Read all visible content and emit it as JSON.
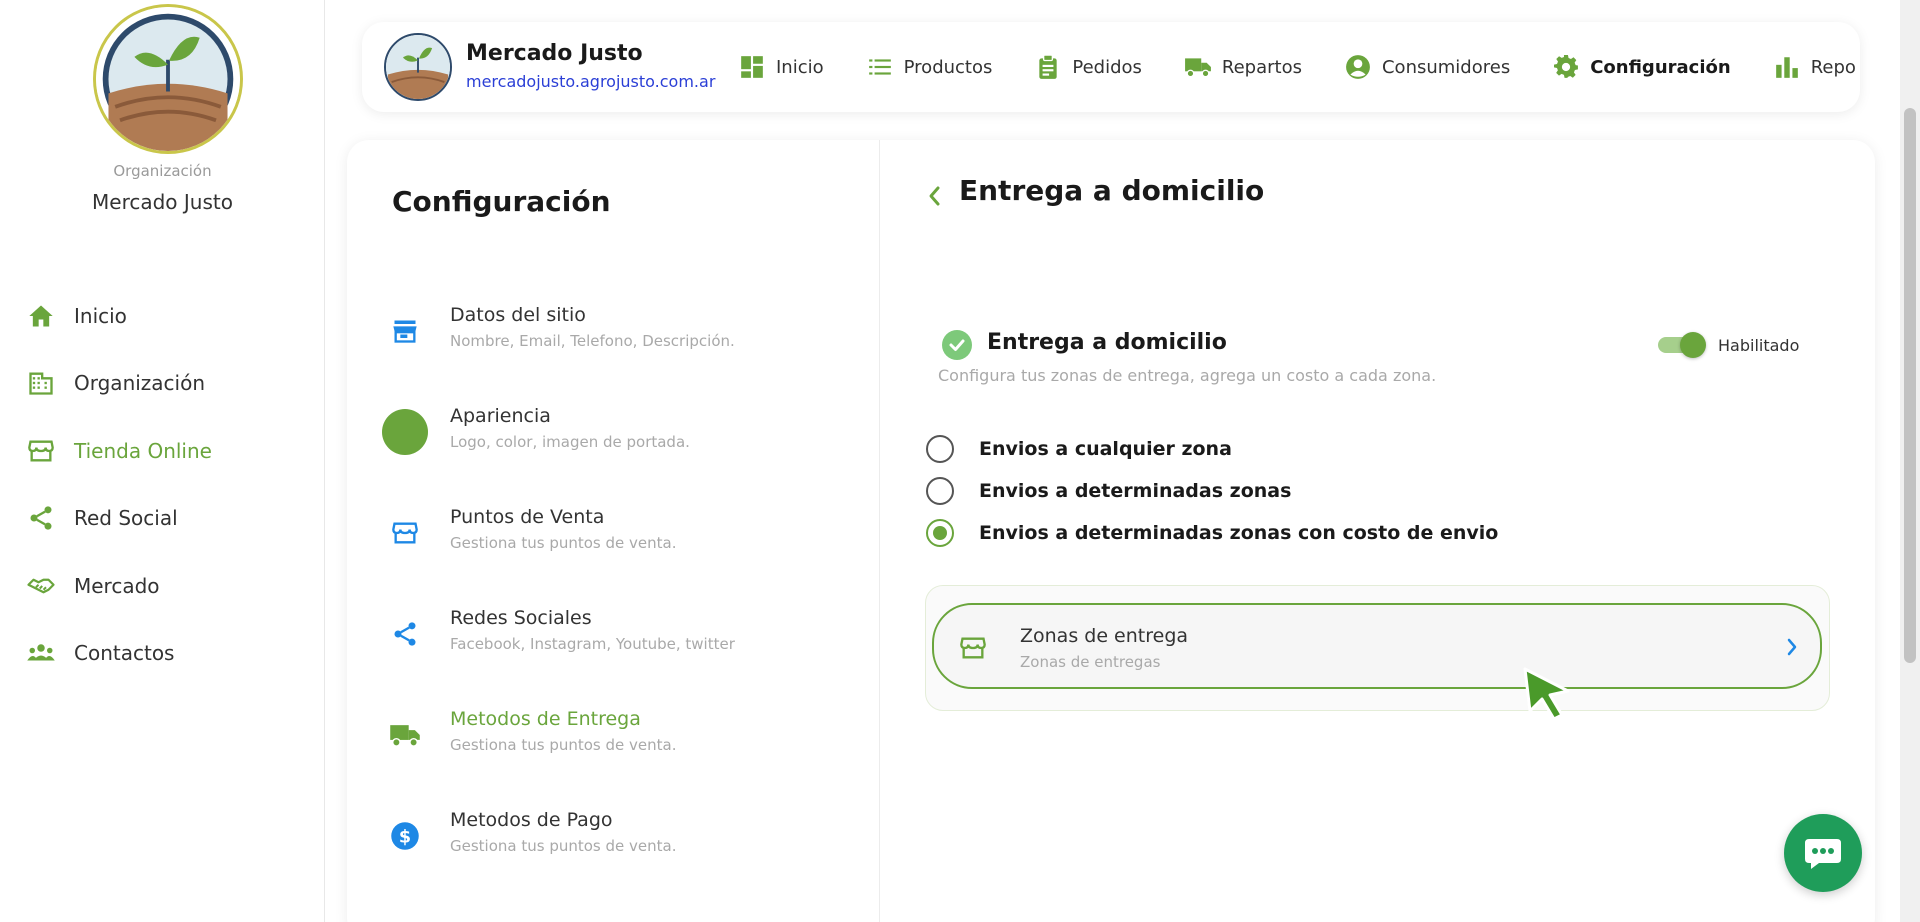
{
  "sidebar": {
    "org_caption": "Organización",
    "org_name": "Mercado Justo",
    "items": [
      {
        "label": "Inicio",
        "icon": "home-icon"
      },
      {
        "label": "Organización",
        "icon": "building-icon"
      },
      {
        "label": "Tienda Online",
        "icon": "storefront-icon",
        "active": true
      },
      {
        "label": "Red Social",
        "icon": "share-icon"
      },
      {
        "label": "Mercado",
        "icon": "handshake-icon"
      },
      {
        "label": "Contactos",
        "icon": "people-icon"
      }
    ]
  },
  "header": {
    "brand_name": "Mercado Justo",
    "brand_url": "mercadojusto.agrojusto.com.ar",
    "nav": [
      {
        "label": "Inicio",
        "icon": "dashboard-icon"
      },
      {
        "label": "Productos",
        "icon": "list-icon"
      },
      {
        "label": "Pedidos",
        "icon": "clipboard-icon"
      },
      {
        "label": "Repartos",
        "icon": "truck-icon"
      },
      {
        "label": "Consumidores",
        "icon": "user-circle-icon"
      },
      {
        "label": "Configuración",
        "icon": "gear-icon",
        "active": true
      },
      {
        "label": "Repo",
        "icon": "bar-chart-icon"
      }
    ]
  },
  "settings": {
    "title": "Configuración",
    "items": [
      {
        "title": "Datos del sitio",
        "subtitle": "Nombre, Email, Telefono, Descripción.",
        "icon": "store-icon"
      },
      {
        "title": "Apariencia",
        "subtitle": "Logo, color, imagen de portada.",
        "icon": "color-swatch-icon"
      },
      {
        "title": "Puntos de Venta",
        "subtitle": "Gestiona tus puntos de venta.",
        "icon": "storefront-icon"
      },
      {
        "title": "Redes Sociales",
        "subtitle": "Facebook, Instagram, Youtube, twitter",
        "icon": "share-icon"
      },
      {
        "title": "Metodos de Entrega",
        "subtitle": "Gestiona tus puntos de venta.",
        "icon": "truck-icon",
        "active": true
      },
      {
        "title": "Metodos de Pago",
        "subtitle": "Gestiona tus puntos de venta.",
        "icon": "dollar-icon"
      }
    ]
  },
  "detail": {
    "title": "Entrega a domicilio",
    "section_title": "Entrega a domicilio",
    "section_subtitle": "Configura tus zonas de entrega, agrega un costo a cada zona.",
    "toggle_label": "Habilitado",
    "toggle_on": true,
    "options": [
      {
        "label": "Envios a cualquier zona",
        "checked": false
      },
      {
        "label": "Envios a determinadas zonas",
        "checked": false
      },
      {
        "label": "Envios a determinadas zonas con costo de envio",
        "checked": true
      }
    ],
    "zones": {
      "title": "Zonas de entrega",
      "subtitle": "Zonas de entregas"
    }
  },
  "colors": {
    "accent": "#6aa53c",
    "link": "#2b3fd6",
    "blue_icon": "#1e88e5",
    "chat": "#1f9d5a",
    "check": "#7dc97a"
  }
}
